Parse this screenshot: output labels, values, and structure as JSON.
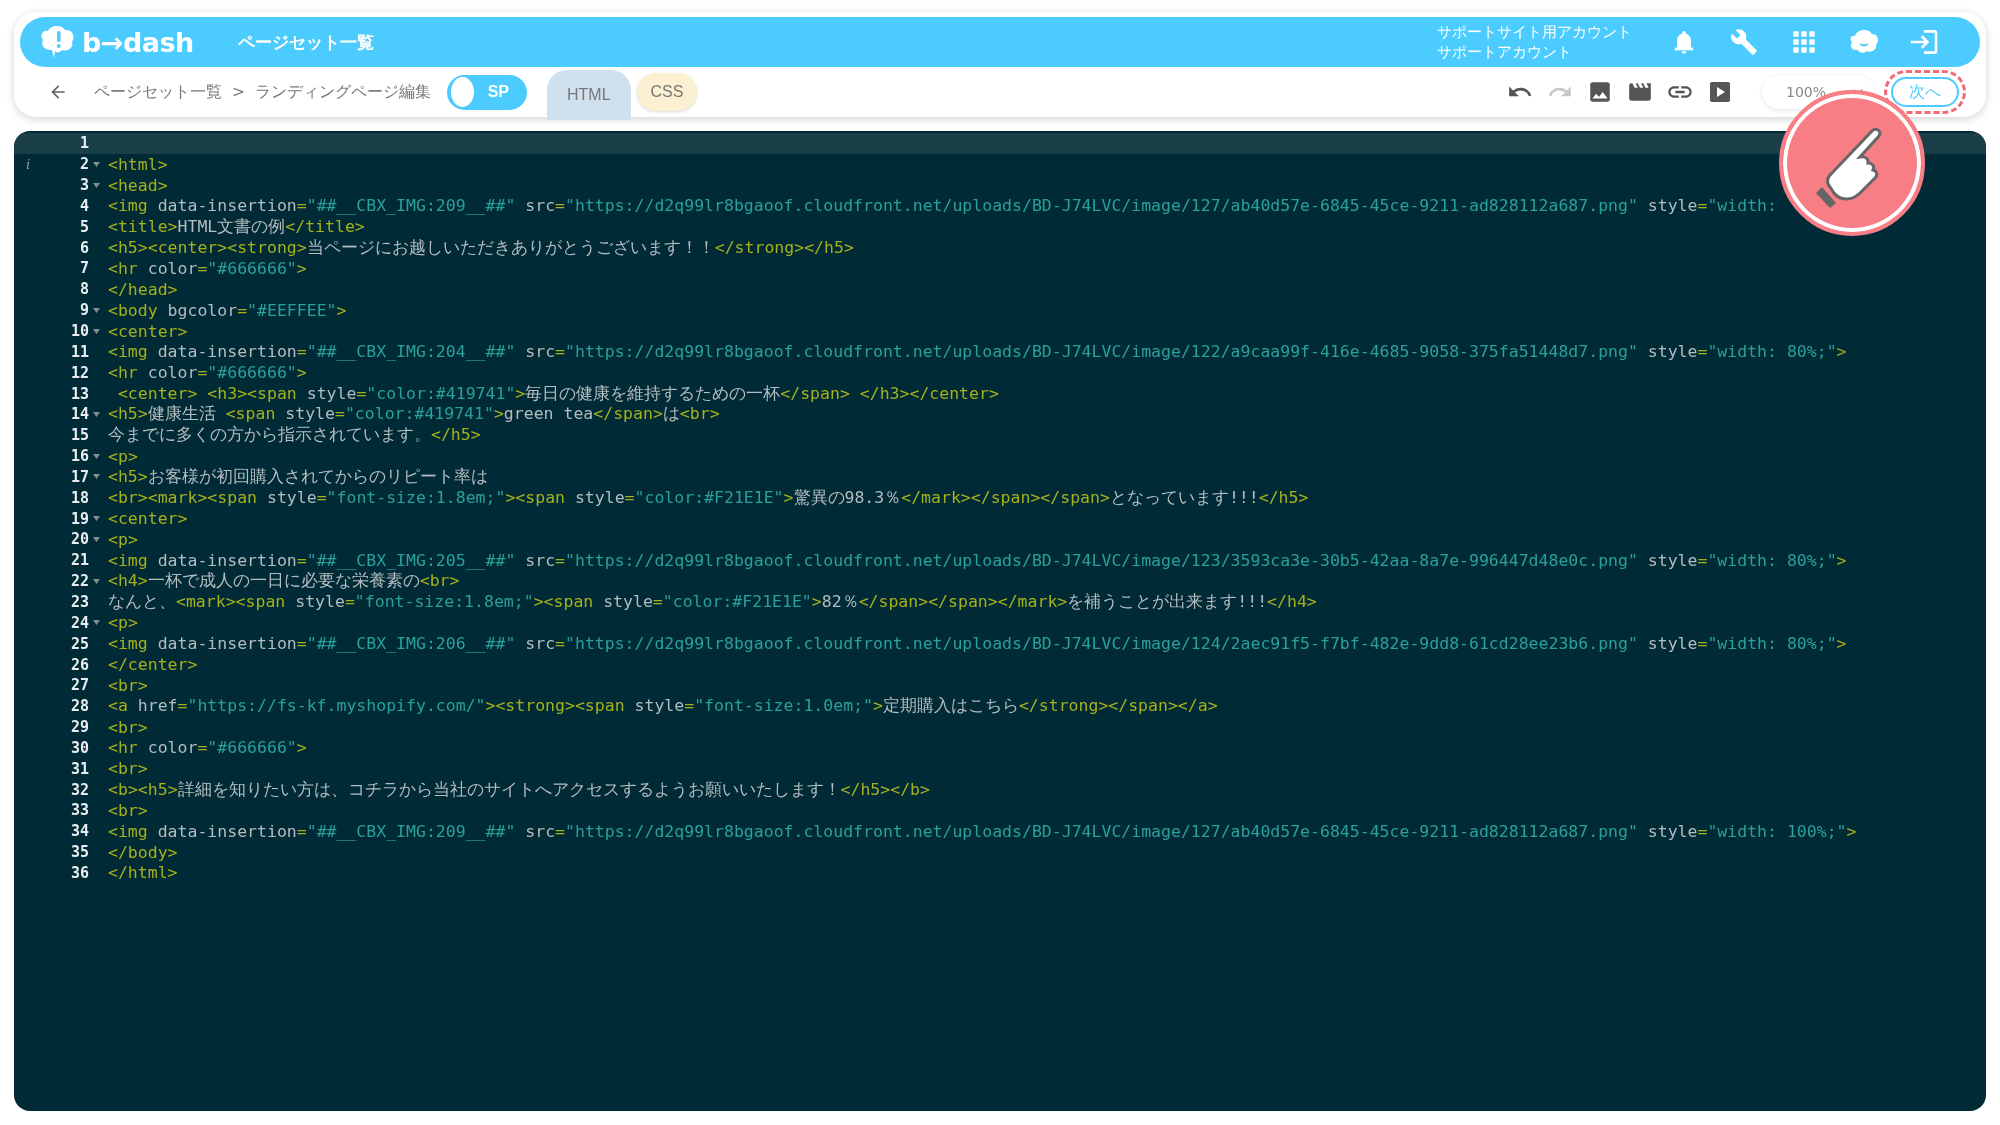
{
  "header": {
    "logo": "b→dash",
    "title": "ページセット一覧",
    "account": [
      "サポートサイト用アカウント",
      "サポートアカウント"
    ]
  },
  "breadcrumb": {
    "items": [
      "ページセット一覧",
      "ランディングページ編集"
    ],
    "separator": ">"
  },
  "sp_toggle": {
    "label": "SP",
    "on": false
  },
  "tabs": [
    {
      "label": "HTML",
      "selected": true
    },
    {
      "label": "CSS",
      "selected": false
    }
  ],
  "toolbar": [
    {
      "kind": "undo",
      "disabled": false
    },
    {
      "kind": "redo",
      "disabled": true
    },
    {
      "kind": "image",
      "disabled": false
    },
    {
      "kind": "video",
      "disabled": false
    },
    {
      "kind": "link",
      "disabled": false
    },
    {
      "kind": "play",
      "disabled": false
    }
  ],
  "zoom": {
    "value": "100%"
  },
  "next_button": {
    "label": "次へ",
    "highlighted": true
  },
  "editor": {
    "lines": [
      {
        "n": "1",
        "fold": false,
        "active": true
      },
      {
        "n": "2",
        "fold": true,
        "active": false,
        "gutter_mark": "i",
        "code": "<html>"
      },
      {
        "n": "3",
        "fold": true,
        "active": false,
        "code": "<head>"
      },
      {
        "n": "4",
        "fold": false,
        "active": false,
        "code": "<img data-insertion=\"##__CBX_IMG:209__##\" src=\"https://d2q99lr8bgaoof.cloudfront.net/uploads/BD-J74LVC/image/127/ab40d57e-6845-45ce-9211-ad828112a687.png\" style=\"width:"
      },
      {
        "n": "5",
        "fold": false,
        "active": false,
        "code": "<title>HTML文書の例</title>"
      },
      {
        "n": "6",
        "fold": false,
        "active": false,
        "code": "<h5><center><strong>当ページにお越しいただきありがとうございます！！</strong></h5>"
      },
      {
        "n": "7",
        "fold": false,
        "active": false,
        "code": "<hr color=\"#666666\">"
      },
      {
        "n": "8",
        "fold": false,
        "active": false,
        "code": "</head>"
      },
      {
        "n": "9",
        "fold": true,
        "active": false,
        "code": "<body bgcolor=\"#EEFFEE\">"
      },
      {
        "n": "10",
        "fold": true,
        "active": false,
        "code": "<center>"
      },
      {
        "n": "11",
        "fold": false,
        "active": false,
        "code": "<img data-insertion=\"##__CBX_IMG:204__##\" src=\"https://d2q99lr8bgaoof.cloudfront.net/uploads/BD-J74LVC/image/122/a9caa99f-416e-4685-9058-375fa51448d7.png\" style=\"width: 80%;\">"
      },
      {
        "n": "12",
        "fold": false,
        "active": false,
        "code": "<hr color=\"#666666\">"
      },
      {
        "n": "13",
        "fold": false,
        "active": false,
        "code": " <center> <h3><span style=\"color:#419741\">毎日の健康を維持するための一杯</span> </h3></center>"
      },
      {
        "n": "14",
        "fold": true,
        "active": false,
        "code": "<h5>健康生活 <span style=\"color:#419741\">green tea</span>は<br>"
      },
      {
        "n": "15",
        "fold": false,
        "active": false,
        "code": "今までに多くの方から指示されています。</h5>"
      },
      {
        "n": "16",
        "fold": true,
        "active": false,
        "code": "<p>"
      },
      {
        "n": "17",
        "fold": true,
        "active": false,
        "code": "<h5>お客様が初回購入されてからのリピート率は"
      },
      {
        "n": "18",
        "fold": false,
        "active": false,
        "code": "<br><mark><span style=\"font-size:1.8em;\"><span style=\"color:#F21E1E\">驚異の98.3％</mark></span></span>となっています!!!</h5>"
      },
      {
        "n": "19",
        "fold": true,
        "active": false,
        "code": "<center>"
      },
      {
        "n": "20",
        "fold": true,
        "active": false,
        "code": "<p>"
      },
      {
        "n": "21",
        "fold": false,
        "active": false,
        "code": "<img data-insertion=\"##__CBX_IMG:205__##\" src=\"https://d2q99lr8bgaoof.cloudfront.net/uploads/BD-J74LVC/image/123/3593ca3e-30b5-42aa-8a7e-996447d48e0c.png\" style=\"width: 80%;\">"
      },
      {
        "n": "22",
        "fold": true,
        "active": false,
        "code": "<h4>一杯で成人の一日に必要な栄養素の<br>"
      },
      {
        "n": "23",
        "fold": false,
        "active": false,
        "code": "なんと、<mark><span style=\"font-size:1.8em;\"><span style=\"color:#F21E1E\">82％</span></span></mark>を補うことが出来ます!!!</h4>"
      },
      {
        "n": "24",
        "fold": true,
        "active": false,
        "code": "<p>"
      },
      {
        "n": "25",
        "fold": false,
        "active": false,
        "code": "<img data-insertion=\"##__CBX_IMG:206__##\" src=\"https://d2q99lr8bgaoof.cloudfront.net/uploads/BD-J74LVC/image/124/2aec91f5-f7bf-482e-9dd8-61cd28ee23b6.png\" style=\"width: 80%;\">"
      },
      {
        "n": "26",
        "fold": false,
        "active": false,
        "code": "</center>"
      },
      {
        "n": "27",
        "fold": false,
        "active": false,
        "code": "<br>"
      },
      {
        "n": "28",
        "fold": false,
        "active": false,
        "code": "<a href=\"https://fs-kf.myshopify.com/\"><strong><span style=\"font-size:1.0em;\">定期購入はこちら</strong></span></a>"
      },
      {
        "n": "29",
        "fold": false,
        "active": false,
        "code": "<br>"
      },
      {
        "n": "30",
        "fold": false,
        "active": false,
        "code": "<hr color=\"#666666\">"
      },
      {
        "n": "31",
        "fold": false,
        "active": false,
        "code": "<br>"
      },
      {
        "n": "32",
        "fold": false,
        "active": false,
        "code": "<b><h5>詳細を知りたい方は、コチラから当社のサイトへアクセスするようお願いいたします！</h5></b>"
      },
      {
        "n": "33",
        "fold": false,
        "active": false,
        "code": "<br>"
      },
      {
        "n": "34",
        "fold": false,
        "active": false,
        "code": "<img data-insertion=\"##__CBX_IMG:209__##\" src=\"https://d2q99lr8bgaoof.cloudfront.net/uploads/BD-J74LVC/image/127/ab40d57e-6845-45ce-9211-ad828112a687.png\" style=\"width: 100%;\">"
      },
      {
        "n": "35",
        "fold": false,
        "active": false,
        "code": "</body>"
      },
      {
        "n": "36",
        "fold": false,
        "active": false,
        "code": "</html>"
      }
    ]
  }
}
